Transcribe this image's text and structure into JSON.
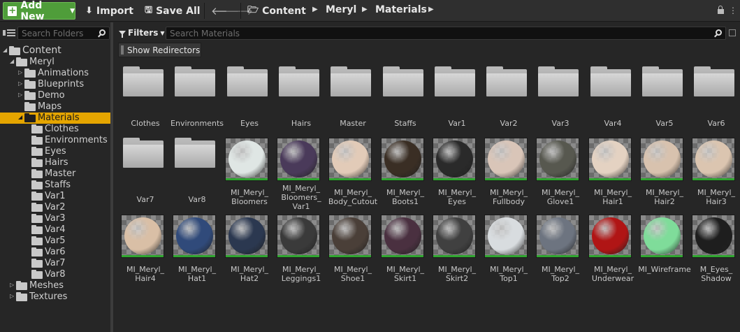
{
  "toolbar": {
    "add_new": "Add New",
    "import": "Import",
    "save_all": "Save All",
    "breadcrumbs": [
      "Content",
      "Meryl",
      "Materials"
    ]
  },
  "left": {
    "search_placeholder": "Search Folders",
    "tree": [
      {
        "label": "Content",
        "depth": 0,
        "expanded": true
      },
      {
        "label": "Meryl",
        "depth": 1,
        "expanded": true
      },
      {
        "label": "Animations",
        "depth": 2,
        "expanded": false
      },
      {
        "label": "Blueprints",
        "depth": 2,
        "expanded": false
      },
      {
        "label": "Demo",
        "depth": 2,
        "expanded": false
      },
      {
        "label": "Maps",
        "depth": 2
      },
      {
        "label": "Materials",
        "depth": 2,
        "expanded": true,
        "selected": true
      },
      {
        "label": "Clothes",
        "depth": 3
      },
      {
        "label": "Environments",
        "depth": 3
      },
      {
        "label": "Eyes",
        "depth": 3
      },
      {
        "label": "Hairs",
        "depth": 3
      },
      {
        "label": "Master",
        "depth": 3
      },
      {
        "label": "Staffs",
        "depth": 3
      },
      {
        "label": "Var1",
        "depth": 3
      },
      {
        "label": "Var2",
        "depth": 3
      },
      {
        "label": "Var3",
        "depth": 3
      },
      {
        "label": "Var4",
        "depth": 3
      },
      {
        "label": "Var5",
        "depth": 3
      },
      {
        "label": "Var6",
        "depth": 3
      },
      {
        "label": "Var7",
        "depth": 3
      },
      {
        "label": "Var8",
        "depth": 3
      },
      {
        "label": "Meshes",
        "depth": 1,
        "expanded": false
      },
      {
        "label": "Textures",
        "depth": 1,
        "expanded": false
      }
    ]
  },
  "right": {
    "filters_label": "Filters",
    "search_placeholder": "Search Materials",
    "show_redirectors": "Show Redirectors"
  },
  "assets": [
    {
      "kind": "folder",
      "name": [
        "Clothes"
      ]
    },
    {
      "kind": "folder",
      "name": [
        "Environments"
      ]
    },
    {
      "kind": "folder",
      "name": [
        "Eyes"
      ]
    },
    {
      "kind": "folder",
      "name": [
        "Hairs"
      ]
    },
    {
      "kind": "folder",
      "name": [
        "Master"
      ]
    },
    {
      "kind": "folder",
      "name": [
        "Staffs"
      ]
    },
    {
      "kind": "folder",
      "name": [
        "Var1"
      ]
    },
    {
      "kind": "folder",
      "name": [
        "Var2"
      ]
    },
    {
      "kind": "folder",
      "name": [
        "Var3"
      ]
    },
    {
      "kind": "folder",
      "name": [
        "Var4"
      ]
    },
    {
      "kind": "folder",
      "name": [
        "Var5"
      ]
    },
    {
      "kind": "folder",
      "name": [
        "Var6"
      ]
    },
    {
      "kind": "folder",
      "name": [
        "Var7"
      ]
    },
    {
      "kind": "folder",
      "name": [
        "Var8"
      ]
    },
    {
      "kind": "material",
      "name": [
        "MI_Meryl_",
        "Bloomers"
      ],
      "color": "#dfe6e4"
    },
    {
      "kind": "material",
      "name": [
        "MI_Meryl_",
        "Bloomers_",
        "Var1"
      ],
      "color": "#4a3a5a"
    },
    {
      "kind": "material",
      "name": [
        "MI_Meryl_",
        "Body_Cutout"
      ],
      "color": "#e2cbb8"
    },
    {
      "kind": "material",
      "name": [
        "MI_Meryl_",
        "Boots1"
      ],
      "color": "#3a2e24"
    },
    {
      "kind": "material",
      "name": [
        "MI_Meryl_",
        "Eyes"
      ],
      "color": "#2a2a2a"
    },
    {
      "kind": "material",
      "name": [
        "MI_Meryl_",
        "Fullbody"
      ],
      "color": "#d9c5b8"
    },
    {
      "kind": "material",
      "name": [
        "MI_Meryl_",
        "Glove1"
      ],
      "color": "#57584f"
    },
    {
      "kind": "material",
      "name": [
        "MI_Meryl_",
        "Hair1"
      ],
      "color": "#e4d2c2"
    },
    {
      "kind": "material",
      "name": [
        "MI_Meryl_",
        "Hair2"
      ],
      "color": "#d8c2ae"
    },
    {
      "kind": "material",
      "name": [
        "MI_Meryl_",
        "Hair3"
      ],
      "color": "#dbc5b0"
    },
    {
      "kind": "material",
      "name": [
        "MI_Meryl_",
        "Hair4"
      ],
      "color": "#d9bfa6"
    },
    {
      "kind": "material",
      "name": [
        "MI_Meryl_",
        "Hat1"
      ],
      "color": "#304a7a"
    },
    {
      "kind": "material",
      "name": [
        "MI_Meryl_",
        "Hat2"
      ],
      "color": "#2b3850"
    },
    {
      "kind": "material",
      "name": [
        "MI_Meryl_",
        "Leggings1"
      ],
      "color": "#3a3a3a"
    },
    {
      "kind": "material",
      "name": [
        "MI_Meryl_",
        "Shoe1"
      ],
      "color": "#4a3f38"
    },
    {
      "kind": "material",
      "name": [
        "MI_Meryl_",
        "Skirt1"
      ],
      "color": "#4a3040"
    },
    {
      "kind": "material",
      "name": [
        "MI_Meryl_",
        "Skirt2"
      ],
      "color": "#404040"
    },
    {
      "kind": "material",
      "name": [
        "MI_Meryl_",
        "Top1"
      ],
      "color": "#d8dcdf"
    },
    {
      "kind": "material",
      "name": [
        "MI_Meryl_",
        "Top2"
      ],
      "color": "#6d7480"
    },
    {
      "kind": "material",
      "name": [
        "MI_Meryl_",
        "Underwear"
      ],
      "color": "#b01515"
    },
    {
      "kind": "material",
      "name": [
        "MI_Wireframe"
      ],
      "color": "#7fdc9a"
    },
    {
      "kind": "material",
      "name": [
        "M_Eyes_",
        "Shadow"
      ],
      "color": "#1e1e1e"
    }
  ]
}
